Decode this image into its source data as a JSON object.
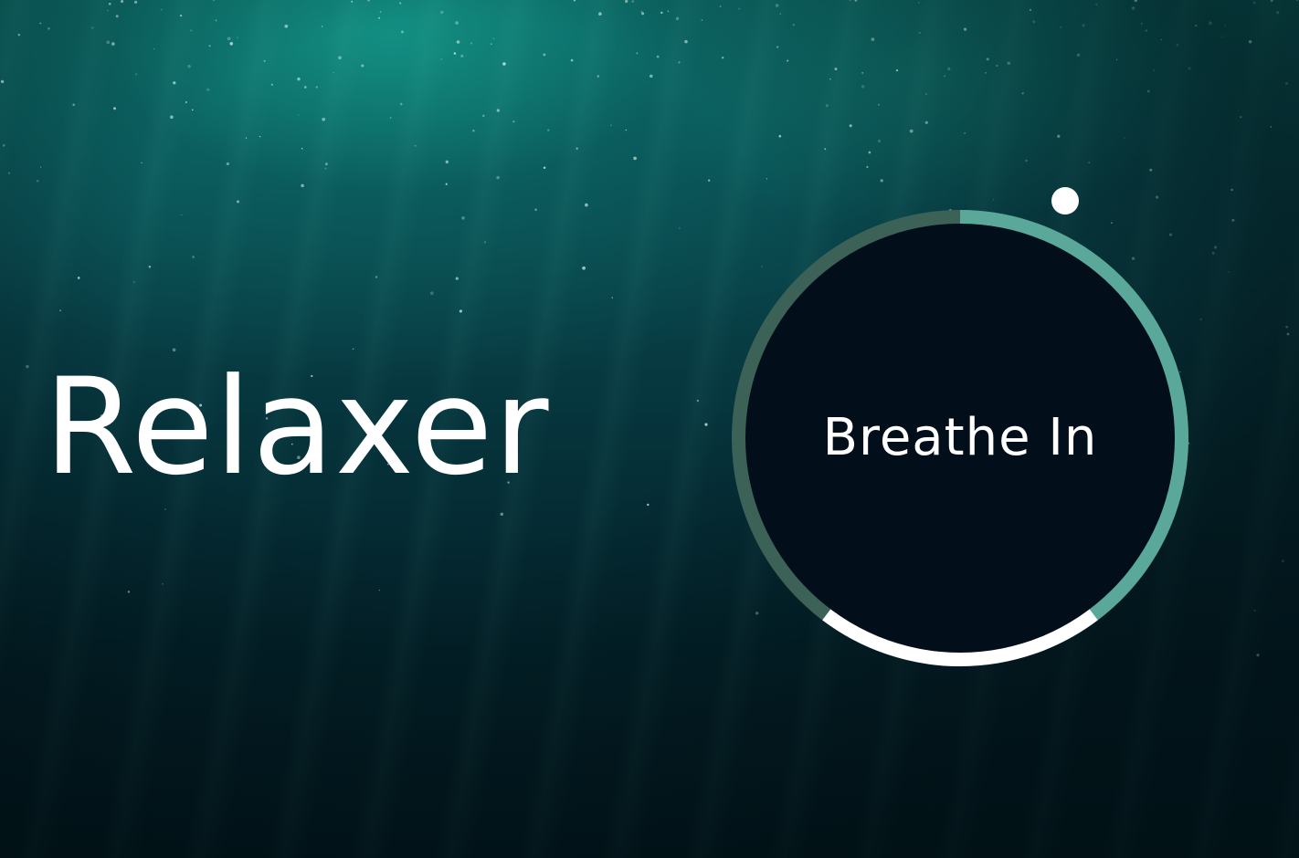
{
  "app": {
    "title": "Relaxer"
  },
  "breathing": {
    "instruction": "Breathe In"
  },
  "colors": {
    "ring_inhale": "#5aa899",
    "ring_hold": "#3c6258",
    "ring_exhale": "#ffffff",
    "inner": "#020e1a",
    "pointer": "#ffffff",
    "text": "#ffffff"
  },
  "icons": {
    "pointer": "pointer-dot-icon"
  }
}
